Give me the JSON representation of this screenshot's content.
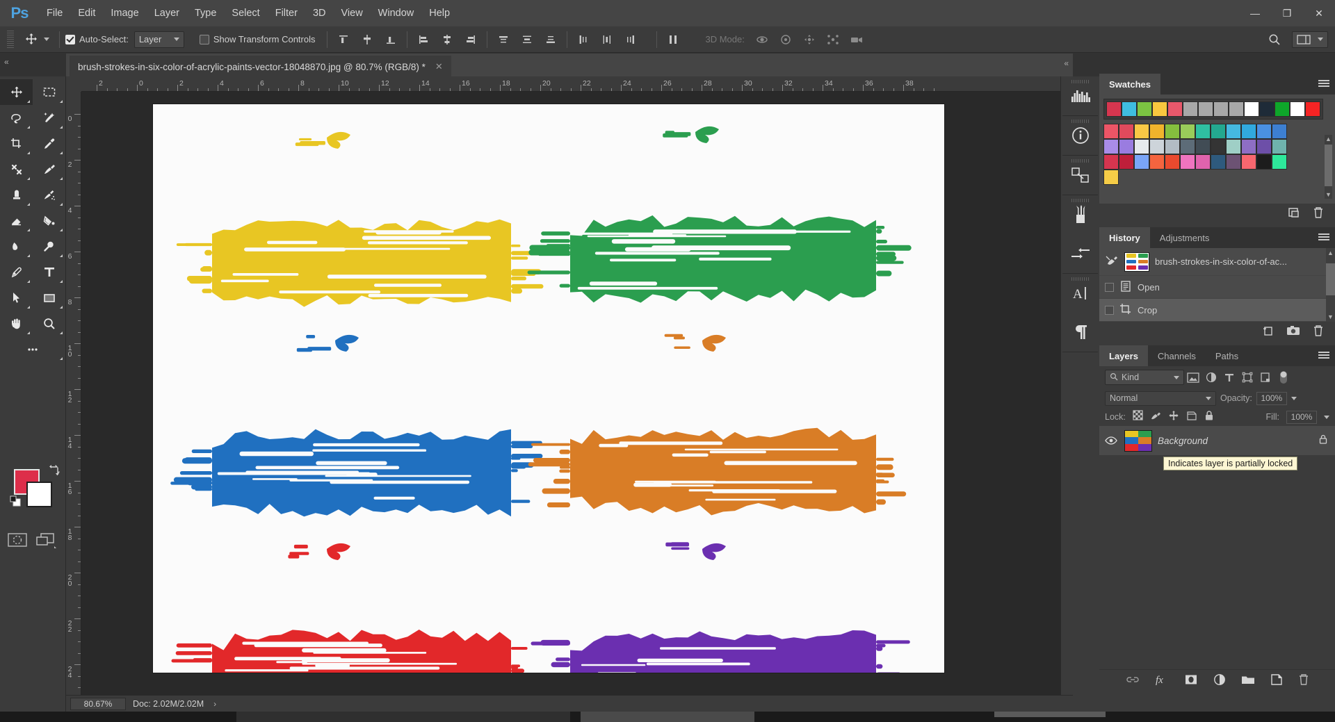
{
  "app": {
    "logo": "Ps",
    "title": "Adobe Photoshop"
  },
  "menubar": {
    "items": [
      "File",
      "Edit",
      "Image",
      "Layer",
      "Type",
      "Select",
      "Filter",
      "3D",
      "View",
      "Window",
      "Help"
    ],
    "window_controls": {
      "minimize": "—",
      "maximize": "❐",
      "close": "✕"
    }
  },
  "options_bar": {
    "tool": "move-tool",
    "auto_select_checked": true,
    "auto_select_label": "Auto-Select:",
    "auto_select_value": "Layer",
    "show_transform_label": "Show Transform Controls",
    "show_transform_checked": false,
    "align_left_edges": "align-left-edges",
    "align_horizontal_centers": "align-horizontal-centers",
    "align_right_edges": "align-right-edges",
    "align_top_edges": "align-top-edges",
    "align_vertical_centers": "align-vertical-centers",
    "align_bottom_edges": "align-bottom-edges",
    "distribute_top": "distribute-top",
    "distribute_vcenter": "distribute-vertical-center",
    "distribute_bottom": "distribute-bottom",
    "distribute_left": "distribute-left",
    "distribute_hcenter": "distribute-horizontal-center",
    "distribute_right": "distribute-right",
    "three_d_mode_label": "3D Mode:"
  },
  "document": {
    "tab_title": "brush-strokes-in-six-color-of-acrylic-paints-vector-18048870.jpg @ 80.7% (RGB/8) *",
    "close_glyph": "✕"
  },
  "rulers": {
    "unit_hint": "inches",
    "horizontal": [
      "2",
      "0",
      "2",
      "4",
      "6",
      "8",
      "10",
      "12",
      "14",
      "16",
      "18",
      "20",
      "22",
      "24",
      "26",
      "28",
      "30",
      "32",
      "34",
      "36",
      "38"
    ],
    "vertical": [
      "0",
      "2",
      "4",
      "6",
      "8",
      "10",
      "12",
      "14",
      "16",
      "18",
      "20",
      "22",
      "24"
    ]
  },
  "tools": {
    "items": [
      {
        "name": "move-tool",
        "selected": true
      },
      {
        "name": "rectangular-marquee-tool",
        "selected": false
      },
      {
        "name": "lasso-tool",
        "selected": false
      },
      {
        "name": "quick-selection-tool",
        "selected": false
      },
      {
        "name": "crop-tool",
        "selected": false
      },
      {
        "name": "eyedropper-tool",
        "selected": false
      },
      {
        "name": "spot-healing-brush-tool",
        "selected": false
      },
      {
        "name": "brush-tool",
        "selected": false
      },
      {
        "name": "clone-stamp-tool",
        "selected": false
      },
      {
        "name": "history-brush-tool",
        "selected": false
      },
      {
        "name": "eraser-tool",
        "selected": false
      },
      {
        "name": "gradient-tool",
        "selected": false
      },
      {
        "name": "blur-tool",
        "selected": false
      },
      {
        "name": "dodge-tool",
        "selected": false
      },
      {
        "name": "pen-tool",
        "selected": false
      },
      {
        "name": "horizontal-type-tool",
        "selected": false
      },
      {
        "name": "path-selection-tool",
        "selected": false
      },
      {
        "name": "rectangle-tool",
        "selected": false
      },
      {
        "name": "hand-tool",
        "selected": false
      },
      {
        "name": "zoom-tool",
        "selected": false
      },
      {
        "name": "edit-toolbar-tool",
        "selected": false
      }
    ],
    "foreground_color": "#dd2e4a",
    "background_color": "#ffffff",
    "swap_colors": "swap-colors-icon",
    "default_colors": "default-colors-icon",
    "quick_mask": "quick-mask-mode",
    "screen_mode": "change-screen-mode"
  },
  "canvas": {
    "artboard_background": "#fbfbfb",
    "strokes": [
      {
        "color": "#e8c623",
        "name": "yellow-brush-stroke"
      },
      {
        "color": "#2b9e4f",
        "name": "green-brush-stroke"
      },
      {
        "color": "#2070c0",
        "name": "blue-brush-stroke"
      },
      {
        "color": "#d97d26",
        "name": "orange-brush-stroke"
      },
      {
        "color": "#e2282a",
        "name": "red-brush-stroke"
      },
      {
        "color": "#6b2fb0",
        "name": "purple-brush-stroke"
      }
    ]
  },
  "dock_icons": [
    {
      "name": "histogram-icon"
    },
    {
      "name": "info-icon"
    },
    {
      "name": "layer-comps-icon"
    },
    {
      "name": "brushes-icon"
    },
    {
      "name": "brush-settings-icon"
    },
    {
      "name": "character-icon"
    },
    {
      "name": "paragraph-icon"
    }
  ],
  "swatches_panel": {
    "title": "Swatches",
    "menu": "panel-menu-icon",
    "recent_row": [
      "#d6364f",
      "#3fbde0",
      "#7cc342",
      "#f9c83f",
      "#e8586b",
      "#a8a8a8",
      "#a8a8a8",
      "#a8a8a8",
      "#a8a8a8",
      "#ffffff",
      "#1e2b38",
      "#0ea62a",
      "#ffffff",
      "#f52424"
    ],
    "grid": [
      [
        "#ec5566",
        "#e04a5c",
        "#f9c845",
        "#f0b42c",
        "#85bf3e",
        "#99cc5a",
        "#2fbfa1",
        "#23a88f",
        "#45b9e0",
        "#31a9de",
        "#4a90e2",
        "#3d7fd1"
      ],
      [
        "#a98ce8",
        "#9a7ce0",
        "#e6eaed",
        "#cdd4da",
        "#b2bcc4",
        "#5d6c78",
        "#414c55",
        "#343434",
        "#9fcfc6",
        "#8e6ec4",
        "#6d4fa8",
        "#6fb3ad"
      ],
      [
        "#d6354f",
        "#bf1f3a",
        "#7aa5f7",
        "#f4643f",
        "#ea4a2e",
        "#ef74bf",
        "#e063ad",
        "#2e5a7d",
        "#6c5273",
        "#f7676f",
        "#1c1c1c",
        "#2ee89b"
      ],
      [
        "#f5cc47"
      ]
    ],
    "footer_icons": [
      {
        "name": "new-swatch-icon"
      },
      {
        "name": "delete-swatch-icon"
      }
    ]
  },
  "history_panel": {
    "tabs": [
      {
        "label": "History",
        "active": true
      },
      {
        "label": "Adjustments",
        "active": false
      }
    ],
    "menu": "panel-menu-icon",
    "snapshot": {
      "label": "brush-strokes-in-six-color-of-ac...",
      "icon": "history-brush-icon"
    },
    "states": [
      {
        "label": "Open",
        "icon": "open-document-icon",
        "selected": false
      },
      {
        "label": "Crop",
        "icon": "crop-icon",
        "selected": true
      }
    ],
    "footer_icons": [
      {
        "name": "create-document-from-state-icon"
      },
      {
        "name": "create-snapshot-icon"
      },
      {
        "name": "delete-state-icon"
      }
    ]
  },
  "layers_panel": {
    "tabs": [
      {
        "label": "Layers",
        "active": true
      },
      {
        "label": "Channels",
        "active": false
      },
      {
        "label": "Paths",
        "active": false
      }
    ],
    "menu": "panel-menu-icon",
    "filter": {
      "kind_label": "Kind",
      "search_icon": "search-icon",
      "icons": [
        {
          "name": "filter-pixel-icon"
        },
        {
          "name": "filter-adjustment-icon"
        },
        {
          "name": "filter-type-icon"
        },
        {
          "name": "filter-shape-icon"
        },
        {
          "name": "filter-smart-object-icon"
        }
      ],
      "toggle": "filter-toggle-switch"
    },
    "blend_mode": "Normal",
    "opacity_label": "Opacity:",
    "opacity_value": "100%",
    "lock_label": "Lock:",
    "lock_icons": [
      {
        "name": "lock-transparent-pixels-icon"
      },
      {
        "name": "lock-image-pixels-icon"
      },
      {
        "name": "lock-position-icon"
      },
      {
        "name": "lock-artboard-nesting-icon"
      },
      {
        "name": "lock-all-icon"
      }
    ],
    "fill_label": "Fill:",
    "fill_value": "100%",
    "layers": [
      {
        "name": "Background",
        "visible": true,
        "locked": true,
        "thumbnail": "brush-strokes-thumbnail"
      }
    ],
    "tooltip": "Indicates layer is partially locked",
    "footer_icons": [
      {
        "name": "link-layers-icon"
      },
      {
        "name": "layer-style-fx-icon"
      },
      {
        "name": "add-layer-mask-icon"
      },
      {
        "name": "new-adjustment-layer-icon"
      },
      {
        "name": "new-group-icon"
      },
      {
        "name": "new-layer-icon"
      },
      {
        "name": "delete-layer-icon"
      }
    ]
  },
  "status_bar": {
    "zoom": "80.67%",
    "doc_info": "Doc: 2.02M/2.02M",
    "expand_glyph": "›"
  }
}
